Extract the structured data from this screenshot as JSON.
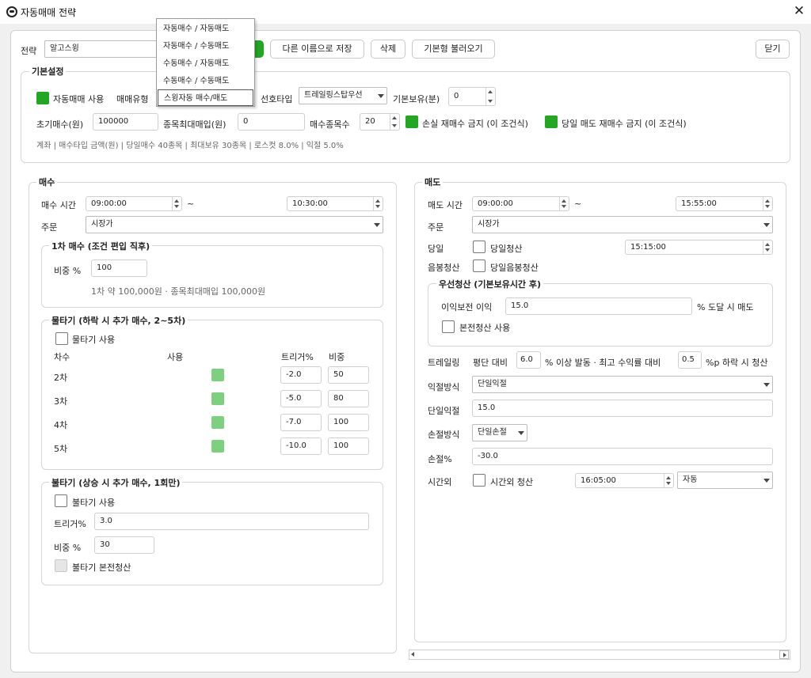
{
  "window": {
    "title": "자동매매 전략",
    "close": "✕"
  },
  "strategy": {
    "label": "전략",
    "value": "알고스윙"
  },
  "toolbar": {
    "save_as": "다른 이름으로 저장",
    "delete": "삭제",
    "load_default": "기본형 불러오기",
    "close": "닫기"
  },
  "basic": {
    "title": "기본설정",
    "auto_trade": "자동매매 사용",
    "trade_type": "매매유형",
    "preferred_type": "선호타입",
    "preferred_value": "트레일링스탑우선",
    "base_hold": "기본보유(분)",
    "base_hold_value": "0",
    "init_buy": "초기매수(원)",
    "init_buy_value": "100000",
    "max_buy": "종목최대매입(원)",
    "max_buy_value": "0",
    "buy_count": "매수종목수",
    "buy_count_value": "20",
    "no_rebuy_loss": "손실 재매수 금지 (이 조건식)",
    "no_rebuy_sell": "당일 매도 재매수 금지 (이 조건식)",
    "summary": "계좌 | 매수타입 금액(원) | 당일매수 40종목 | 최대보유 30종목 | 로스컷 8.0% | 익절 5.0%"
  },
  "dropdown": {
    "items": [
      "자동매수 / 자동매도",
      "자동매수 / 수동매도",
      "수동매수 / 자동매도",
      "수동매수 / 수동매도",
      "스윙자동 매수/매도"
    ],
    "selected_index": 4
  },
  "buy": {
    "title": "매수",
    "time_label": "매수 시간",
    "time_start": "09:00:00",
    "tilde": "~",
    "time_end": "10:30:00",
    "order_label": "주문",
    "order_value": "시장가",
    "first": {
      "title": "1차 매수 (조건 편입 직후)",
      "weight_label": "비중 %",
      "weight_value": "100",
      "note": "1차 약 100,000원 · 종목최대매입 100,000원"
    },
    "water": {
      "title": "물타기 (하락 시 추가 매수, 2~5차)",
      "use": "물타기 사용",
      "headers": {
        "round": "차수",
        "use": "사용",
        "trigger": "트리거%",
        "weight": "비중"
      },
      "rows": [
        {
          "round": "2차",
          "trigger": "-2.0",
          "weight": "50"
        },
        {
          "round": "3차",
          "trigger": "-5.0",
          "weight": "80"
        },
        {
          "round": "4차",
          "trigger": "-7.0",
          "weight": "100"
        },
        {
          "round": "5차",
          "trigger": "-10.0",
          "weight": "100"
        }
      ]
    },
    "fire": {
      "title": "불타기 (상승 시 추가 매수, 1회만)",
      "use": "불타기 사용",
      "trigger_label": "트리거%",
      "trigger_value": "3.0",
      "weight_label": "비중 %",
      "weight_value": "30",
      "breakeven": "불타기 본전청산"
    }
  },
  "sell": {
    "title": "매도",
    "time_label": "매도 시간",
    "time_start": "09:00:00",
    "tilde": "~",
    "time_end": "15:55:00",
    "order_label": "주문",
    "order_value": "시장가",
    "sameday_label": "당일",
    "sameday_check": "당일청산",
    "sameday_time": "15:15:00",
    "bull_label": "음봉청산",
    "bull_check": "당일음봉청산",
    "priority": {
      "title": "우선청산 (기본보유시간 후)",
      "profit_label": "이익보전 이익",
      "profit_value": "15.0",
      "profit_suffix": "% 도달 시 매도",
      "breakeven": "본전청산 사용"
    },
    "trailing": {
      "label": "트레일링",
      "avg": "평단 대비",
      "avg_value": "6.0",
      "mid": "% 이상 발동 · 최고 수익률 대비",
      "drop_value": "0.5",
      "end": "%p 하락 시 청산"
    },
    "take_method_label": "익절방식",
    "take_method_value": "단일익절",
    "take_single_label": "단일익절",
    "take_single_value": "15.0",
    "stop_method_label": "손절방식",
    "stop_method_value": "단일손절",
    "stop_label": "손절%",
    "stop_value": "-30.0",
    "after_label": "시간외",
    "after_check": "시간외 청산",
    "after_time": "16:05:00",
    "after_mode": "자동"
  },
  "colors": {
    "check_on": "#22a722",
    "check_light": "#7dd07d",
    "accent": "#22a722"
  }
}
